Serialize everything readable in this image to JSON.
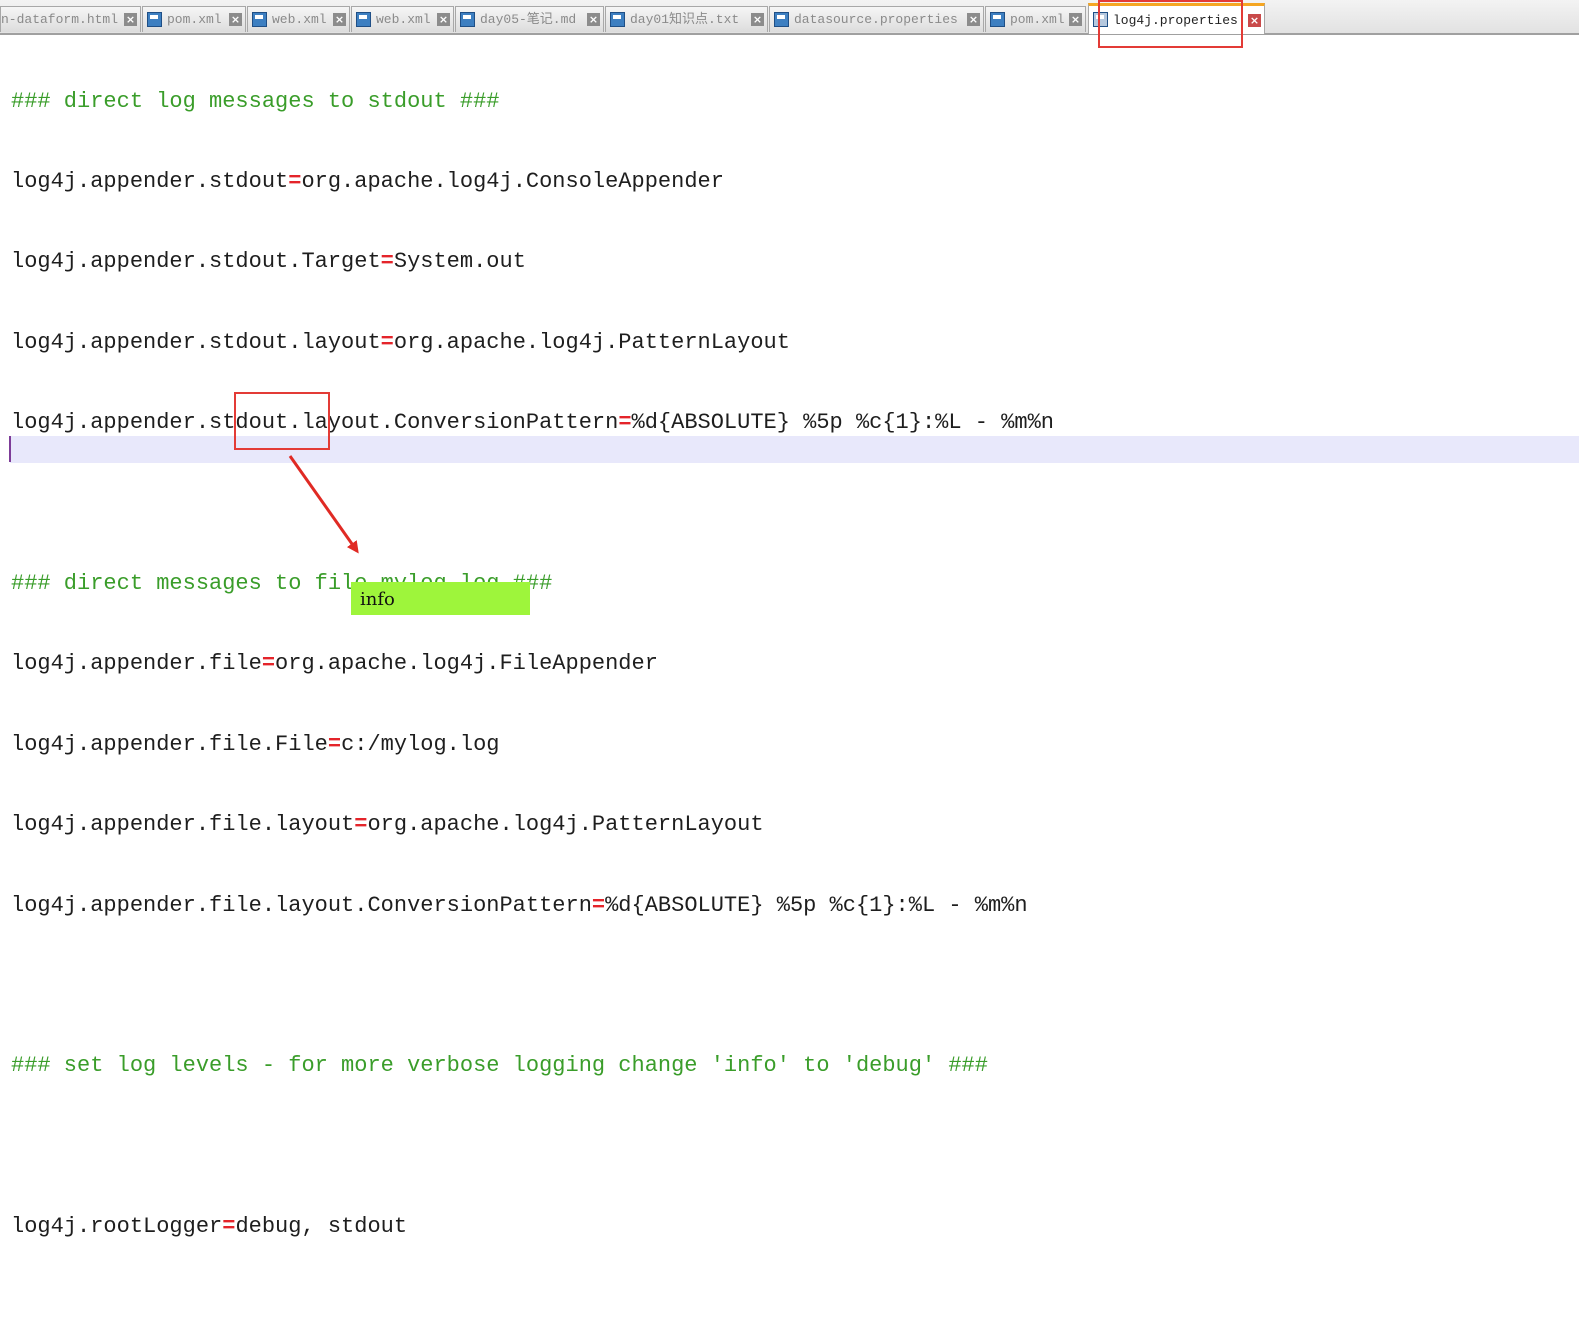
{
  "tabs": [
    {
      "label": "n-dataform.html",
      "active": false
    },
    {
      "label": "pom.xml",
      "active": false
    },
    {
      "label": "web.xml",
      "active": false
    },
    {
      "label": "web.xml",
      "active": false
    },
    {
      "label": "day05-笔记.md",
      "active": false
    },
    {
      "label": "day01知识点.txt",
      "active": false
    },
    {
      "label": "datasource.properties",
      "active": false
    },
    {
      "label": "pom.xml",
      "active": false
    },
    {
      "label": "log4j.properties",
      "active": true
    }
  ],
  "tab_close_glyph": "×",
  "editor": {
    "lines": [
      {
        "type": "comment",
        "text": "### direct log messages to stdout ###"
      },
      {
        "type": "prop",
        "key": "log4j.appender.stdout",
        "eq": "=",
        "value": "org.apache.log4j.ConsoleAppender"
      },
      {
        "type": "prop",
        "key": "log4j.appender.stdout.Target",
        "eq": "=",
        "value": "System.out"
      },
      {
        "type": "prop",
        "key": "log4j.appender.stdout.layout",
        "eq": "=",
        "value": "org.apache.log4j.PatternLayout"
      },
      {
        "type": "prop",
        "key": "log4j.appender.stdout.layout.ConversionPattern",
        "eq": "=",
        "value": "%d{ABSOLUTE} %5p %c{1}:%L - %m%n"
      },
      {
        "type": "blank",
        "text": ""
      },
      {
        "type": "comment",
        "text": "### direct messages to file mylog.log ###"
      },
      {
        "type": "prop",
        "key": "log4j.appender.file",
        "eq": "=",
        "value": "org.apache.log4j.FileAppender"
      },
      {
        "type": "prop",
        "key": "log4j.appender.file.File",
        "eq": "=",
        "value": "c:/mylog.log"
      },
      {
        "type": "prop",
        "key": "log4j.appender.file.layout",
        "eq": "=",
        "value": "org.apache.log4j.PatternLayout"
      },
      {
        "type": "prop",
        "key": "log4j.appender.file.layout.ConversionPattern",
        "eq": "=",
        "value": "%d{ABSOLUTE} %5p %c{1}:%L - %m%n"
      },
      {
        "type": "blank",
        "text": ""
      },
      {
        "type": "comment",
        "text": "### set log levels - for more verbose logging change 'info' to 'debug' ###"
      },
      {
        "type": "blank",
        "text": ""
      },
      {
        "type": "prop",
        "key": "log4j.rootLogger",
        "eq": "=",
        "value": "debug, stdout"
      },
      {
        "type": "blank",
        "text": ""
      }
    ]
  },
  "annotation": {
    "note_text": "info",
    "box_color": "#e33b36",
    "note_color": "#9ef53b"
  },
  "colors": {
    "comment": "#3a9d2a",
    "equals": "#e4242a",
    "active_tab_accent": "#f5a623",
    "current_line": "#e8e8fb"
  }
}
